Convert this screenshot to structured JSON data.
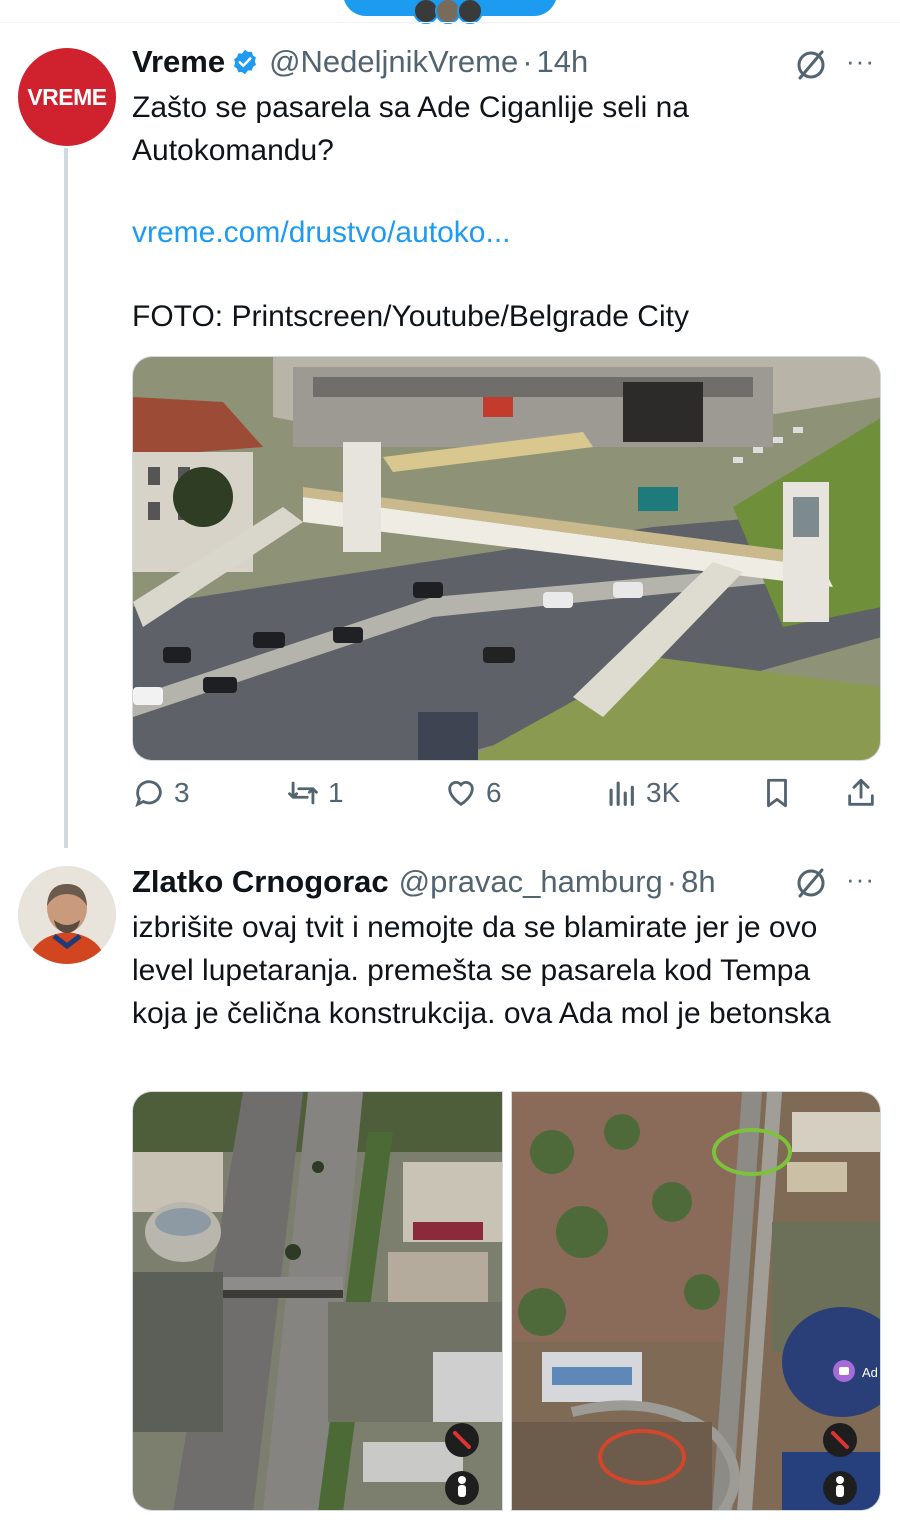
{
  "tweets": [
    {
      "name": "Vreme",
      "handle": "@NedeljnikVreme",
      "time": "14h",
      "avatar_text": "VREME",
      "text": "Zašto se pasarela sa Ade Ciganlije seli na Autokomandu?",
      "link": "vreme.com/drustvo/autoko...",
      "credit": "FOTO: Printscreen/Youtube/Belgrade City",
      "stats": {
        "replies": "3",
        "retweets": "1",
        "likes": "6",
        "views": "3K"
      }
    },
    {
      "name": "Zlatko Crnogorac",
      "handle": "@pravac_hamburg",
      "time": "8h",
      "text": "izbrišite ovaj tvit i nemojte da se blamirate jer je ovo level lupetaranja. premešta se pasarela kod Tempa koja je čelična konstrukcija. ova Ada mol je betonska",
      "map_label": "Ad"
    }
  ],
  "separator": "·",
  "more": "···",
  "icons": [
    "verified-badge-icon",
    "grok-icon",
    "more-icon",
    "reply-icon",
    "retweet-icon",
    "like-icon",
    "views-icon",
    "bookmark-icon",
    "share-icon",
    "compass-icon",
    "pegman-icon"
  ],
  "colors": {
    "accent": "#1d9bf0",
    "vreme_red": "#d0212e",
    "muted": "#536471"
  }
}
